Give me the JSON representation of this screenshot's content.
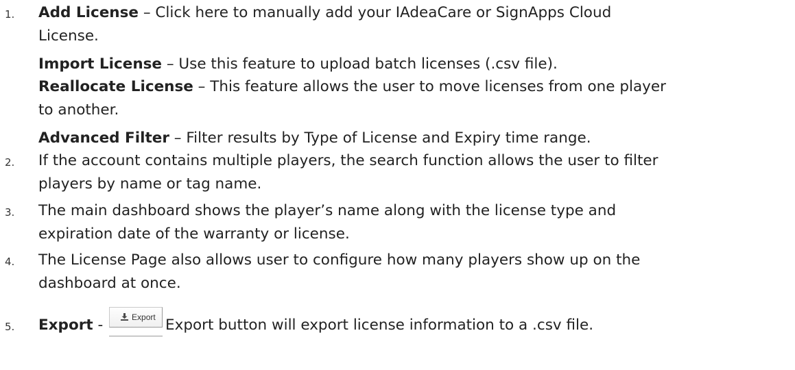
{
  "items": [
    {
      "number": "1.",
      "title": "Add License",
      "text_line1": " – Click here to manually add your IAdeaCare or SignApps Cloud",
      "text_line2": "License."
    },
    {
      "title": "Import License",
      "text": " – Use this feature to upload batch licenses (.csv file)."
    },
    {
      "title": "Reallocate License",
      "text_line1": " – This feature allows the user to move licenses from one player",
      "text_line2": "to another."
    },
    {
      "title": "Advanced Filter",
      "text": " – Filter results by Type of License and Expiry time range."
    },
    {
      "number": "2.",
      "text_line1": "If the account contains multiple players, the search function allows the user to filter",
      "text_line2": "players by name or tag name."
    },
    {
      "number": "3.",
      "text_line1": "The main dashboard shows the player’s name along with the license type and",
      "text_line2": "expiration date of the warranty or license."
    },
    {
      "number": "4.",
      "text_line1": "The License Page also allows user to configure how many players show up on the",
      "text_line2": "dashboard at once."
    },
    {
      "number": "5.",
      "title": "Export",
      "separator": " - ",
      "button_label": "Export",
      "button_icon": "download-icon",
      "text": "Export button will export license information to a .csv file."
    }
  ]
}
